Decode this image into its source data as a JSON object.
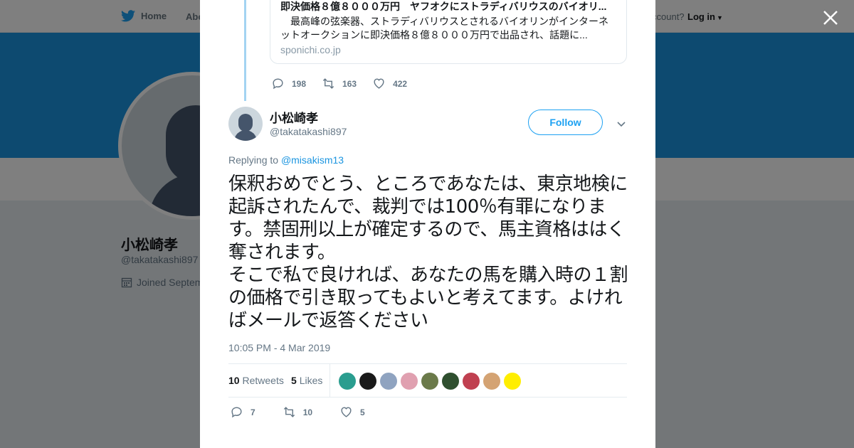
{
  "background": {
    "nav": {
      "home": "Home",
      "about": "Abo",
      "account": "ccount?",
      "login": "Log in"
    },
    "profile": {
      "name": "小松崎孝",
      "handle": "@takatakashi897",
      "joined": "Joined Septem"
    }
  },
  "card": {
    "title": "即決価格８億８０００万円　ヤフオクにストラディバリウスのバイオリ...",
    "description": "　最高峰の弦楽器、ストラディバリウスとされるバイオリンがインターネットオークションに即決価格８億８０００万円で出品され、話題に...",
    "domain": "sponichi.co.jp"
  },
  "previous_tweet_actions": {
    "replies": "198",
    "retweets": "163",
    "likes": "422"
  },
  "tweet": {
    "author_name": "小松崎孝",
    "author_handle": "@takatakashi897",
    "follow_label": "Follow",
    "replying_prefix": "Replying to ",
    "replying_to": "@misakism13",
    "text": "保釈おめでとう、ところであなたは、東京地検に起訴されたんで、裁判では100％有罪になります。禁固刑以上が確定するので、馬主資格ははく奪されます。\nそこで私で良ければ、あなたの馬を購入時の１割の価格で引き取ってもよいと考えてます。よければメールで返答ください",
    "timestamp": "10:05 PM - 4 Mar 2019",
    "retweets_count": "10",
    "retweets_label": "Retweets",
    "likes_count": "5",
    "likes_label": "Likes",
    "actions": {
      "replies": "7",
      "retweets": "10",
      "likes": "5"
    }
  },
  "liker_colors": [
    "#2a9d8f",
    "#1a1a1a",
    "#8fa3c0",
    "#e0a0b0",
    "#6b7a4a",
    "#2f4f2f",
    "#c04050",
    "#d4a373",
    "#ffee00"
  ],
  "colors": {
    "accent": "#1da1f2",
    "banner": "#1b95e0"
  }
}
